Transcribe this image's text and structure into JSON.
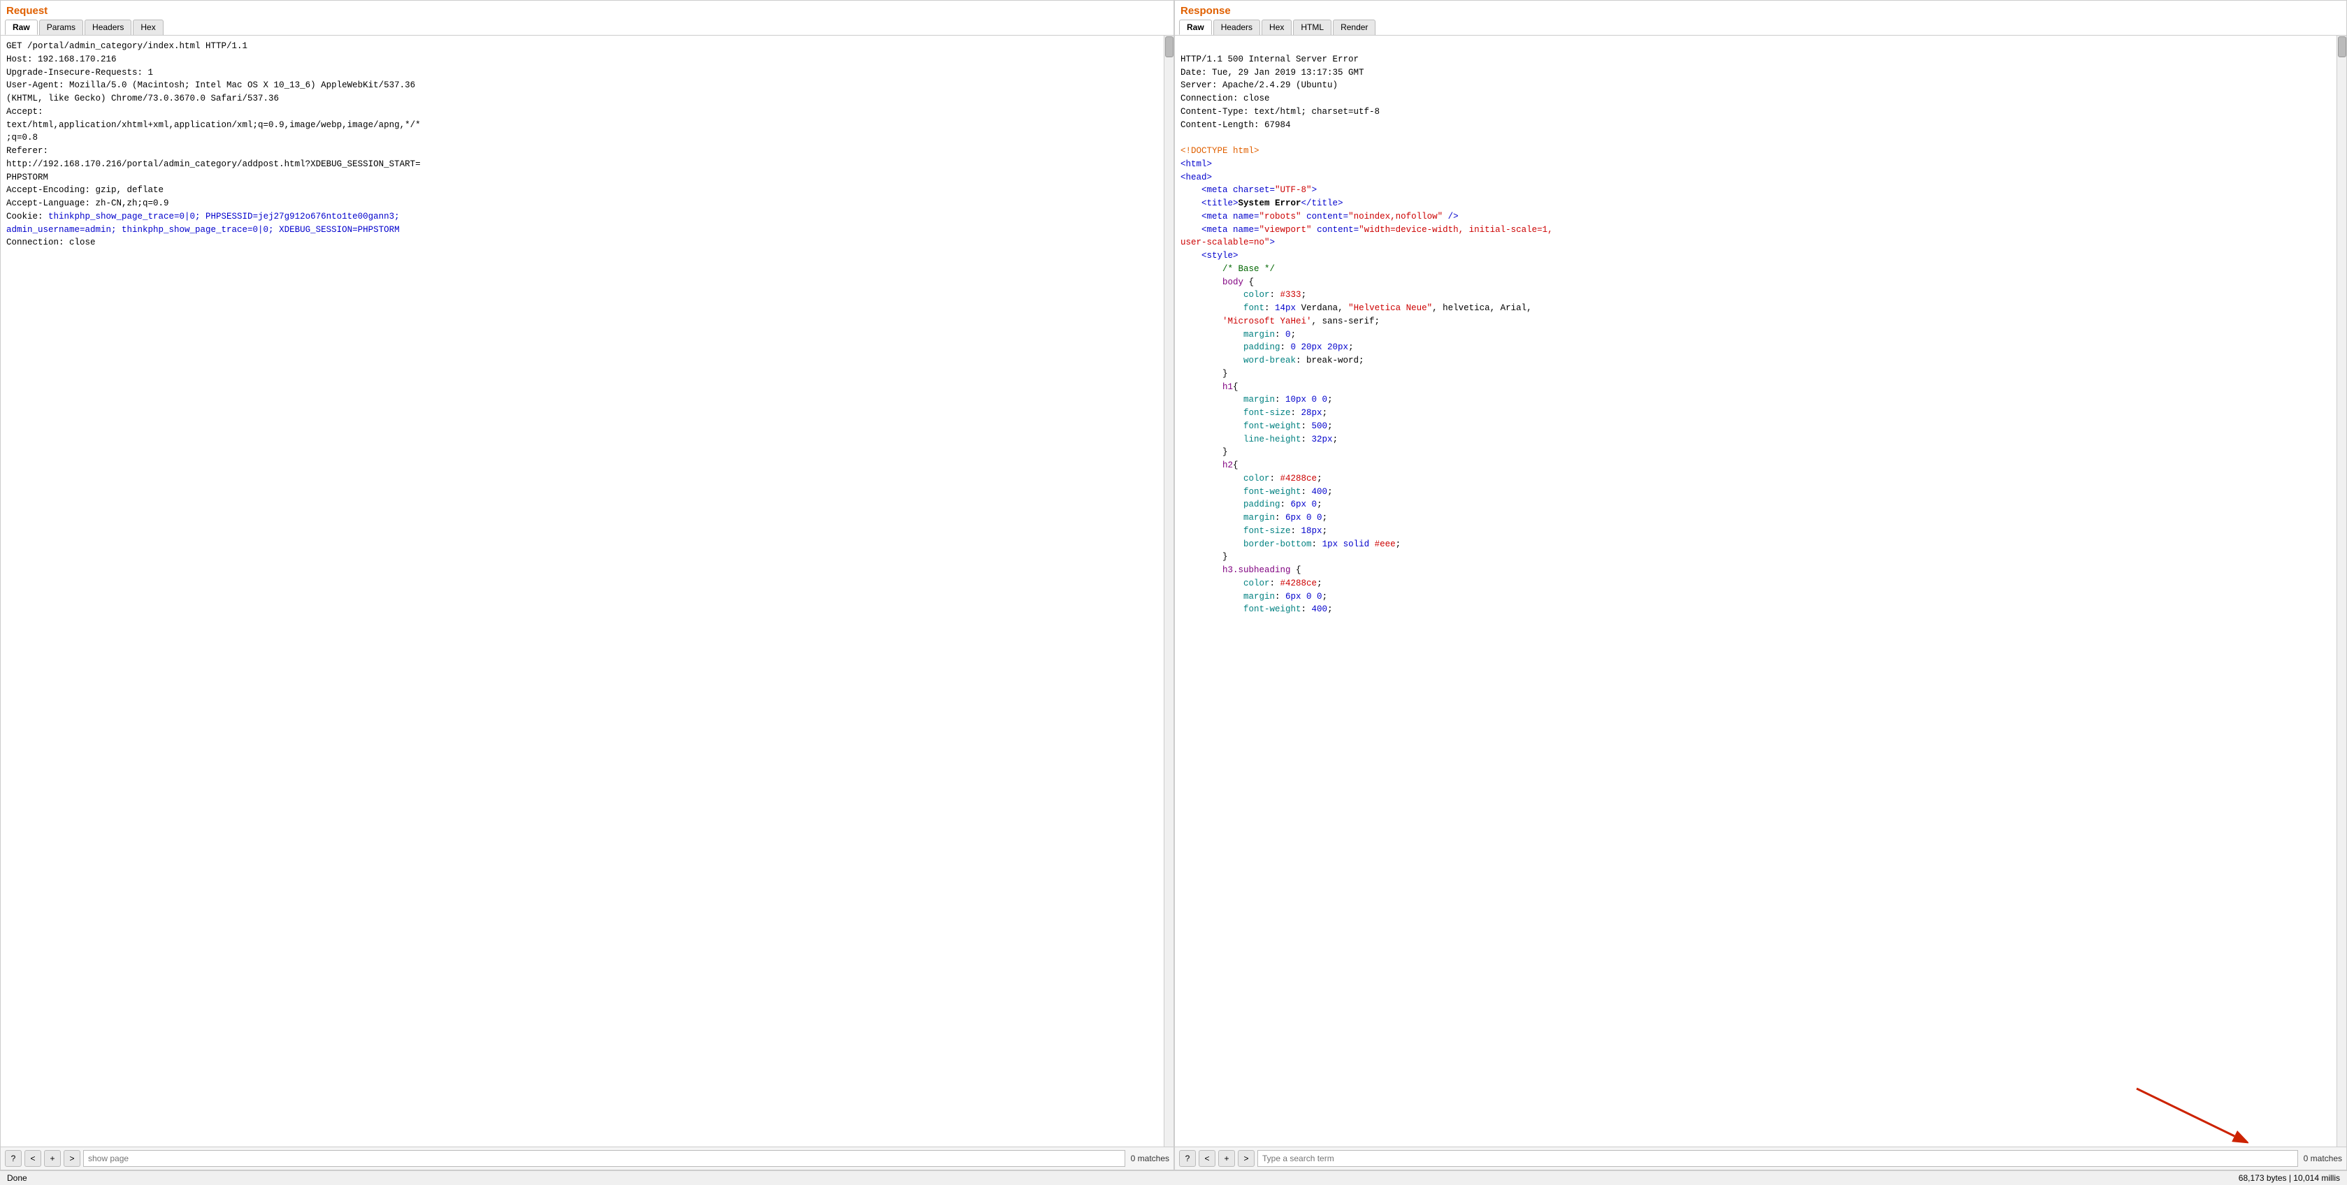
{
  "request": {
    "title": "Request",
    "tabs": [
      {
        "label": "Raw",
        "active": true
      },
      {
        "label": "Params",
        "active": false
      },
      {
        "label": "Headers",
        "active": false
      },
      {
        "label": "Hex",
        "active": false
      }
    ],
    "content_plain": "GET /portal/admin_category/index.html HTTP/1.1\nHost: 192.168.170.216\nUpgrade-Insecure-Requests: 1\nUser-Agent: Mozilla/5.0 (Macintosh; Intel Mac OS X 10_13_6) AppleWebKit/537.36\n(KHTML, like Gecko) Chrome/73.0.3670.0 Safari/537.36\nAccept:\ntext/html,application/xhtml+xml,application/xml;q=0.9,image/webp,image/apng,*/*\n;q=0.8\nReferer:\nhttp://192.168.170.216/portal/admin_category/addpost.html?XDEBUG_SESSION_START=\nPHPSTORM\nAccept-Encoding: gzip, deflate\nAccept-Language: zh-CN,zh;q=0.9",
    "cookie_line": "Cookie: thinkphp_show_page_trace=0|0; PHPSESSID=jej27g912o676nto1te00gann3;\nadmin_username=admin; thinkphp_show_page_trace=0|0; XDEBUG_SESSION=PHPSTORM",
    "connection_line": "Connection: close",
    "bottom": {
      "help_icon": "?",
      "prev_btn": "<",
      "add_btn": "+",
      "next_btn": ">",
      "search_placeholder": "show page",
      "match_count": "0 matches"
    }
  },
  "response": {
    "title": "Response",
    "tabs": [
      {
        "label": "Raw",
        "active": true
      },
      {
        "label": "Headers",
        "active": false
      },
      {
        "label": "Hex",
        "active": false
      },
      {
        "label": "HTML",
        "active": false
      },
      {
        "label": "Render",
        "active": false
      }
    ],
    "header_lines": [
      "HTTP/1.1 500 Internal Server Error",
      "Date: Tue, 29 Jan 2019 13:17:35 GMT",
      "Server: Apache/2.4.29 (Ubuntu)",
      "Connection: close",
      "Content-Type: text/html; charset=utf-8",
      "Content-Length: 67984"
    ],
    "html_content": {
      "doctype": "<!DOCTYPE html>",
      "html_open": "<html>",
      "head_open": "<head>",
      "meta_charset": "<meta charset=\"UTF-8\">",
      "title_open": "<title>",
      "title_text": "System Error",
      "title_close": "</title>",
      "meta_robots_open": "<meta name=\"robots\" content=\"noindex,nofollow\" />",
      "meta_viewport_open": "<meta name=\"viewport\" content=\"width=device-width, initial-scale=1,",
      "meta_viewport_cont": "user-scalable=no\">",
      "style_open": "<style>",
      "css_comment": "/* Base */",
      "css_body": "body {",
      "css_body_color": "    color: #333;",
      "css_body_font": "    font: 14px Verdana, \"Helvetica Neue\", helvetica, Arial,",
      "css_body_font2": "    'Microsoft YaHei', sans-serif;",
      "css_body_margin": "    margin: 0;",
      "css_body_padding": "    padding: 0 20px 20px;",
      "css_body_wordbreak": "    word-break: break-word;",
      "css_body_close": "}",
      "css_h1": "h1{",
      "css_h1_margin": "    margin: 10px 0 0;",
      "css_h1_fontsize": "    font-size: 28px;",
      "css_h1_fontweight": "    font-weight: 500;",
      "css_h1_lineheight": "    line-height: 32px;",
      "css_h1_close": "}",
      "css_h2": "h2{",
      "css_h2_color": "    color: #4288ce;",
      "css_h2_fontweight": "    font-weight: 400;",
      "css_h2_padding": "    padding: 6px 0;",
      "css_h2_margin": "    margin: 6px 0 0;",
      "css_h2_fontsize": "    font-size: 18px;",
      "css_h2_border": "    border-bottom: 1px solid #eee;",
      "css_h2_close": "}",
      "css_h3": "h3.subheading {",
      "css_h3_color": "    color: #4288ce;",
      "css_h3_margin": "    margin: 6px 0 0;",
      "css_h3_fontweight": "    font-weight: 400;"
    },
    "bottom": {
      "help_icon": "?",
      "prev_btn": "<",
      "add_btn": "+",
      "next_btn": ">",
      "search_placeholder": "Type a search term",
      "match_count": "0 matches"
    },
    "arrow_src": "red arrow pointing to search box"
  },
  "status_bar": {
    "left": "Done",
    "right": "68,173 bytes | 10,014 millis"
  }
}
